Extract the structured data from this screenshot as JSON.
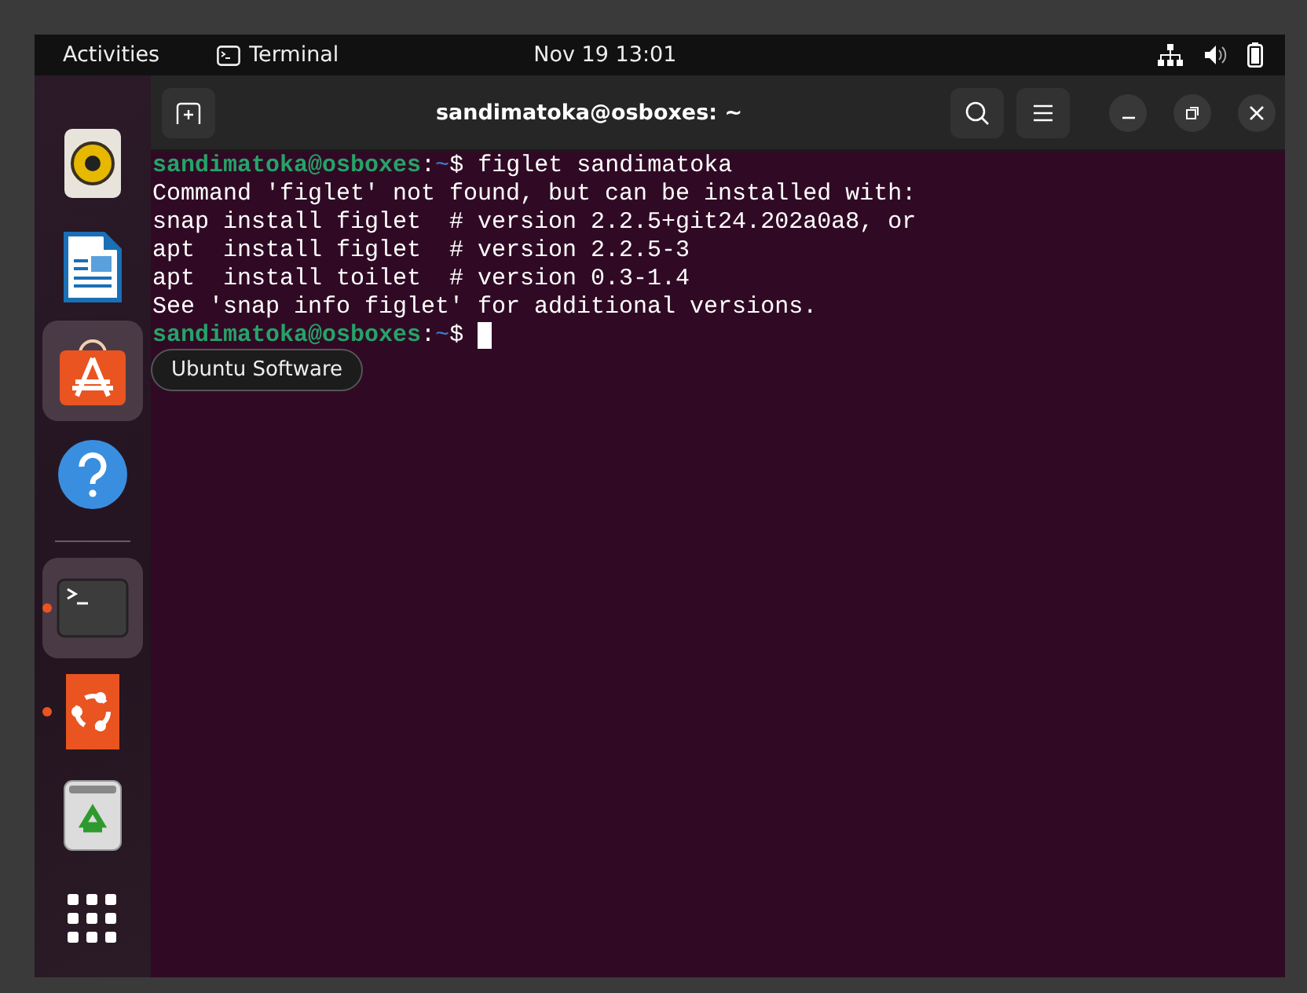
{
  "top_bar": {
    "activities": "Activities",
    "app_name": "Terminal",
    "clock": "Nov 19  13:01"
  },
  "dock": {
    "items": [
      {
        "kind": "speaker",
        "highlighted": false,
        "running": false
      },
      {
        "kind": "document",
        "highlighted": false,
        "running": false
      },
      {
        "kind": "store",
        "highlighted": true,
        "running": false
      },
      {
        "kind": "help",
        "highlighted": false,
        "running": false
      },
      {
        "kind": "separator"
      },
      {
        "kind": "terminal",
        "highlighted": true,
        "running": true
      },
      {
        "kind": "ubuntu",
        "highlighted": false,
        "running": true
      },
      {
        "kind": "trash",
        "highlighted": false,
        "running": false
      },
      {
        "kind": "grid",
        "highlighted": false,
        "running": false
      }
    ],
    "tooltip": "Ubuntu Software"
  },
  "window": {
    "title": "sandimatoka@osboxes: ~"
  },
  "terminal": {
    "cursor_visible": true,
    "lines": [
      {
        "segments": [
          {
            "kind": "user",
            "text": "sandimatoka@osboxes"
          },
          {
            "kind": "plain",
            "text": ":"
          },
          {
            "kind": "path",
            "text": "~"
          },
          {
            "kind": "plain",
            "text": "$ figlet sandimatoka"
          }
        ]
      },
      {
        "segments": [
          {
            "kind": "plain",
            "text": "Command 'figlet' not found, but can be installed with:"
          }
        ]
      },
      {
        "segments": [
          {
            "kind": "plain",
            "text": "snap install figlet  # version 2.2.5+git24.202a0a8, or"
          }
        ]
      },
      {
        "segments": [
          {
            "kind": "plain",
            "text": "apt  install figlet  # version 2.2.5-3"
          }
        ]
      },
      {
        "segments": [
          {
            "kind": "plain",
            "text": "apt  install toilet  # version 0.3-1.4"
          }
        ]
      },
      {
        "segments": [
          {
            "kind": "plain",
            "text": "See 'snap info figlet' for additional versions."
          }
        ]
      },
      {
        "segments": [
          {
            "kind": "user",
            "text": "sandimatoka@osboxes"
          },
          {
            "kind": "plain",
            "text": ":"
          },
          {
            "kind": "path",
            "text": "~"
          },
          {
            "kind": "plain",
            "text": "$ "
          }
        ]
      }
    ]
  }
}
